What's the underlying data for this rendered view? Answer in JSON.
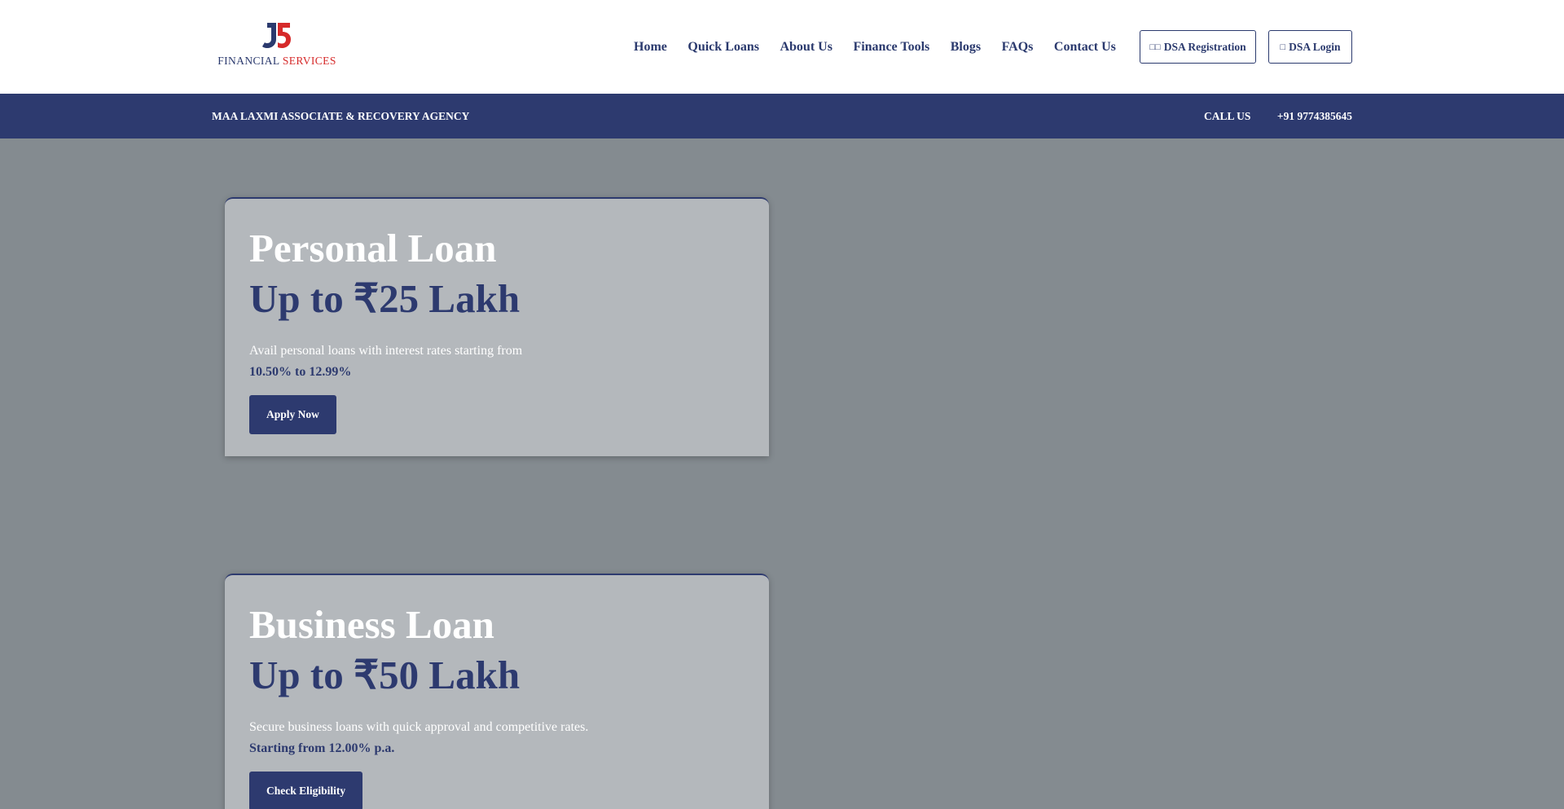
{
  "brand": {
    "logo_text_main": "FINANCIAL ",
    "logo_text_accent": "SERVICES",
    "colors": {
      "navy": "#2d3a6f",
      "red": "#d62a2a"
    }
  },
  "nav": {
    "items": [
      "Home",
      "Quick Loans",
      "About Us",
      "Finance Tools",
      "Blogs",
      "FAQs",
      "Contact Us"
    ],
    "dsa_registration": "DSA Registration",
    "dsa_login": "DSA Login",
    "dsa_registration_icon": "user-plus-icon",
    "dsa_login_icon": "sign-in-icon"
  },
  "topbar": {
    "agency": "MAA LAXMI ASSOCIATE & RECOVERY AGENCY",
    "call_label": "CALL US",
    "phone": "+91 9774385645"
  },
  "cards": [
    {
      "title": "Personal Loan",
      "amount": "Up to ₹25 Lakh",
      "description": "Avail personal loans with interest rates starting from",
      "rate": "10.50% to 12.99%",
      "button": "Apply Now"
    },
    {
      "title": "Business Loan",
      "amount": "Up to ₹50 Lakh",
      "description": "Secure business loans with quick approval and competitive rates.",
      "rate": "Starting from 12.00% p.a.",
      "button": "Check Eligibility"
    }
  ]
}
